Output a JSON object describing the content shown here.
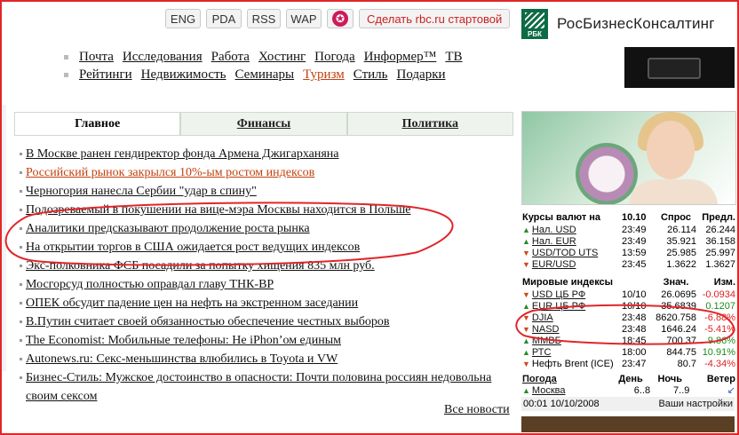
{
  "top_buttons": [
    "ENG",
    "PDA",
    "RSS",
    "WAP"
  ],
  "star_glyph": "✪",
  "startpage_label": "Сделать rbc.ru стартовой",
  "logo": {
    "mark_text": "РБК",
    "name": "РосБизнесКонсалтинг"
  },
  "nav": {
    "row1": [
      "Почта",
      "Исследования",
      "Работа",
      "Хостинг",
      "Погода",
      "Информер™",
      "ТВ"
    ],
    "row2": [
      "Рейтинги",
      "Недвижимость",
      "Семинары",
      "Туризм",
      "Стиль",
      "Подарки"
    ]
  },
  "tabs": [
    "Главное",
    "Финансы",
    "Политика"
  ],
  "news": [
    {
      "text": "В Москве ранен гендиректор фонда Армена Джигарханяна",
      "style": "normal"
    },
    {
      "text": "Российский рынок закрылся 10%-ым ростом индексов",
      "style": "red"
    },
    {
      "text": "Черногория нанесла Сербии \"удар в спину\"",
      "style": "normal"
    },
    {
      "text": "Подозреваемый в покушении на вице-мэра Москвы находится в Польше",
      "style": "normal"
    },
    {
      "text": "Аналитики предсказывают продолжение роста рынка",
      "style": "normal"
    },
    {
      "text": "На открытии торгов в США ожидается рост ведущих индексов",
      "style": "normal"
    },
    {
      "text": "Экс-полковника ФСБ посадили за попытку хищения 835 млн руб.",
      "style": "normal"
    },
    {
      "text": "Мосгорсуд полностью оправдал главу ТНК-ВР",
      "style": "normal"
    },
    {
      "text": "ОПЕК обсудит падение цен на нефть на экстренном заседании",
      "style": "normal"
    },
    {
      "text": "В.Путин считает своей обязанностью обеспечение честных выборов",
      "style": "normal"
    },
    {
      "text": "The Economist: Мобильные телефоны: Не iPhon’ом единым",
      "style": "normal"
    },
    {
      "text": "Autonews.ru: Секс-меньшинства влюбились в Toyota и VW",
      "style": "normal"
    },
    {
      "text": "Бизнес-Стиль: Мужское достоинство в опасности: Почти половина россиян недовольна своим сексом",
      "style": "normal"
    }
  ],
  "all_news": "Все новости",
  "currency": {
    "headers": [
      "Курсы валют на",
      "10.10",
      "Спрос",
      "Предл."
    ],
    "rows": [
      {
        "dir": "up",
        "name": "Нал. USD",
        "time": "23:49",
        "bid": "26.114",
        "ask": "26.244"
      },
      {
        "dir": "up",
        "name": "Нал. EUR",
        "time": "23:49",
        "bid": "35.921",
        "ask": "36.158"
      },
      {
        "dir": "down",
        "name": "USD/TOD UTS",
        "time": "13:59",
        "bid": "25.985",
        "ask": "25.997"
      },
      {
        "dir": "down",
        "name": "EUR/USD",
        "time": "23:45",
        "bid": "1.3622",
        "ask": "1.3627"
      }
    ]
  },
  "indices": {
    "headers": [
      "Мировые индексы",
      "",
      "Знач.",
      "Изм."
    ],
    "rows": [
      {
        "dir": "down",
        "name": "USD ЦБ РФ",
        "time": "10/10",
        "val": "26.0695",
        "chg": "-0.0934",
        "sign": "neg"
      },
      {
        "dir": "up",
        "name": "EUR ЦБ РФ",
        "time": "10/10",
        "val": "35.6839",
        "chg": "0.1207",
        "sign": "pos"
      },
      {
        "dir": "down",
        "name": "DJIA",
        "time": "23:48",
        "val": "8620.758",
        "chg": "-6.88%",
        "sign": "neg"
      },
      {
        "dir": "down",
        "name": "NASD",
        "time": "23:48",
        "val": "1646.24",
        "chg": "-5.41%",
        "sign": "neg"
      },
      {
        "dir": "up",
        "name": "ММВБ",
        "time": "18:45",
        "val": "700.37",
        "chg": "9.86%",
        "sign": "pos"
      },
      {
        "dir": "up",
        "name": "РТС",
        "time": "18:00",
        "val": "844.75",
        "chg": "10.91%",
        "sign": "pos"
      },
      {
        "dir": "down",
        "name": "Нефть Brent (ICE)",
        "time": "23:47",
        "val": "80.7",
        "chg": "-4.34%",
        "sign": "neg"
      }
    ]
  },
  "weather": {
    "headers": [
      "Погода",
      "День",
      "Ночь",
      "Ветер"
    ],
    "city": "Москва",
    "day": "6..8",
    "night": "7..9",
    "wind": "↙"
  },
  "footer": {
    "time": "00:01 10/10/2008",
    "settings": "Ваши настройки"
  },
  "colors": {
    "annotation": "#e0262a",
    "up": "#2a8a2a",
    "down": "#d2461c",
    "logo_green": "#0d6b45"
  }
}
